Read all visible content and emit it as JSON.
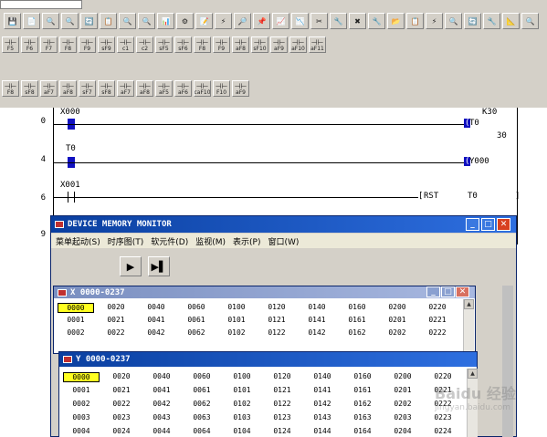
{
  "toolbar_row1": {
    "buttons": [
      "💾",
      "📄",
      "🔍",
      "🔍",
      "🔄",
      "📋",
      "🔍",
      "🔍",
      "📊",
      "⚙",
      "📝",
      "⚡",
      "🔎",
      "📌",
      "📈",
      "📉",
      "✂",
      "🔧",
      "✖",
      "🔧",
      "📂",
      "📋",
      "⚡",
      "🔍",
      "🔄",
      "🔧",
      "📐",
      "🔍"
    ]
  },
  "toolbar_row2": {
    "buttons": [
      "F5",
      "F6",
      "F7",
      "F8",
      "F9",
      "sF9",
      "c1",
      "c2",
      "sF5",
      "sF6",
      "F8",
      "F9",
      "aF8",
      "sF10",
      "aF9",
      "aF10",
      "aF11"
    ]
  },
  "toolbar_row3": {
    "buttons": [
      "F8",
      "sF8",
      "aF7",
      "aF8",
      "sF7",
      "sF8",
      "aF7",
      "aF8",
      "aF5",
      "aF6",
      "caF10",
      "F10",
      "aF9"
    ]
  },
  "ladder": {
    "steps": [
      "0",
      "4",
      "6",
      "9"
    ],
    "contacts": [
      "X000",
      "T0",
      "X001"
    ],
    "coils": [
      "T0",
      "Y000"
    ],
    "timer_const": "K30",
    "timer_value": "30",
    "rst_instr": "RST",
    "rst_target": "T0"
  },
  "monitor_window": {
    "title": "DEVICE MEMORY MONITOR",
    "menu": [
      "菜单起动(S)",
      "时序图(T)",
      "软元件(D)",
      "监视(M)",
      "表示(P)",
      "窗口(W)"
    ]
  },
  "x_window": {
    "title": "X   0000-0237",
    "rows": [
      [
        "0000",
        "0020",
        "0040",
        "0060",
        "0100",
        "0120",
        "0140",
        "0160",
        "0200",
        "0220"
      ],
      [
        "0001",
        "0021",
        "0041",
        "0061",
        "0101",
        "0121",
        "0141",
        "0161",
        "0201",
        "0221"
      ],
      [
        "0002",
        "0022",
        "0042",
        "0062",
        "0102",
        "0122",
        "0142",
        "0162",
        "0202",
        "0222"
      ]
    ],
    "selected": "0000"
  },
  "y_window": {
    "title": "Y   0000-0237",
    "rows": [
      [
        "0000",
        "0020",
        "0040",
        "0060",
        "0100",
        "0120",
        "0140",
        "0160",
        "0200",
        "0220"
      ],
      [
        "0001",
        "0021",
        "0041",
        "0061",
        "0101",
        "0121",
        "0141",
        "0161",
        "0201",
        "0221"
      ],
      [
        "0002",
        "0022",
        "0042",
        "0062",
        "0102",
        "0122",
        "0142",
        "0162",
        "0202",
        "0222"
      ],
      [
        "0003",
        "0023",
        "0043",
        "0063",
        "0103",
        "0123",
        "0143",
        "0163",
        "0203",
        "0223"
      ],
      [
        "0004",
        "0024",
        "0044",
        "0064",
        "0104",
        "0124",
        "0144",
        "0164",
        "0204",
        "0224"
      ]
    ],
    "selected": "0000"
  },
  "watermark": {
    "text": "Baidu 经验",
    "url": "jingyan.baidu.com"
  }
}
